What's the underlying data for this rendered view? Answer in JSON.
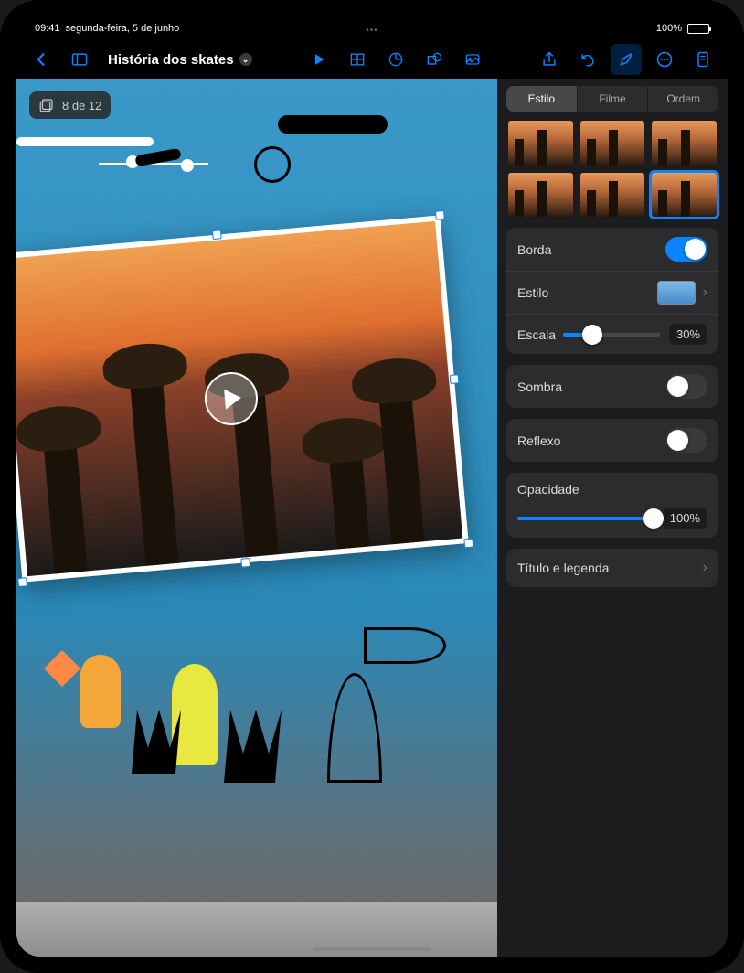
{
  "status": {
    "time": "09:41",
    "date": "segunda-feira, 5 de junho",
    "battery_pct": "100%"
  },
  "toolbar": {
    "doc_title": "História dos skates"
  },
  "canvas": {
    "slide_indicator": "8 de 12"
  },
  "inspector": {
    "tabs": {
      "style": "Estilo",
      "movie": "Filme",
      "order": "Ordem"
    },
    "selected_tab": "style",
    "border": {
      "label": "Borda",
      "on": true
    },
    "style": {
      "label": "Estilo"
    },
    "scale": {
      "label": "Escala",
      "value": "30%",
      "pct": 30
    },
    "shadow": {
      "label": "Sombra",
      "on": false
    },
    "reflect": {
      "label": "Reflexo",
      "on": false
    },
    "opacity": {
      "label": "Opacidade",
      "value": "100%",
      "pct": 100
    },
    "caption": {
      "label": "Título e legenda"
    }
  }
}
